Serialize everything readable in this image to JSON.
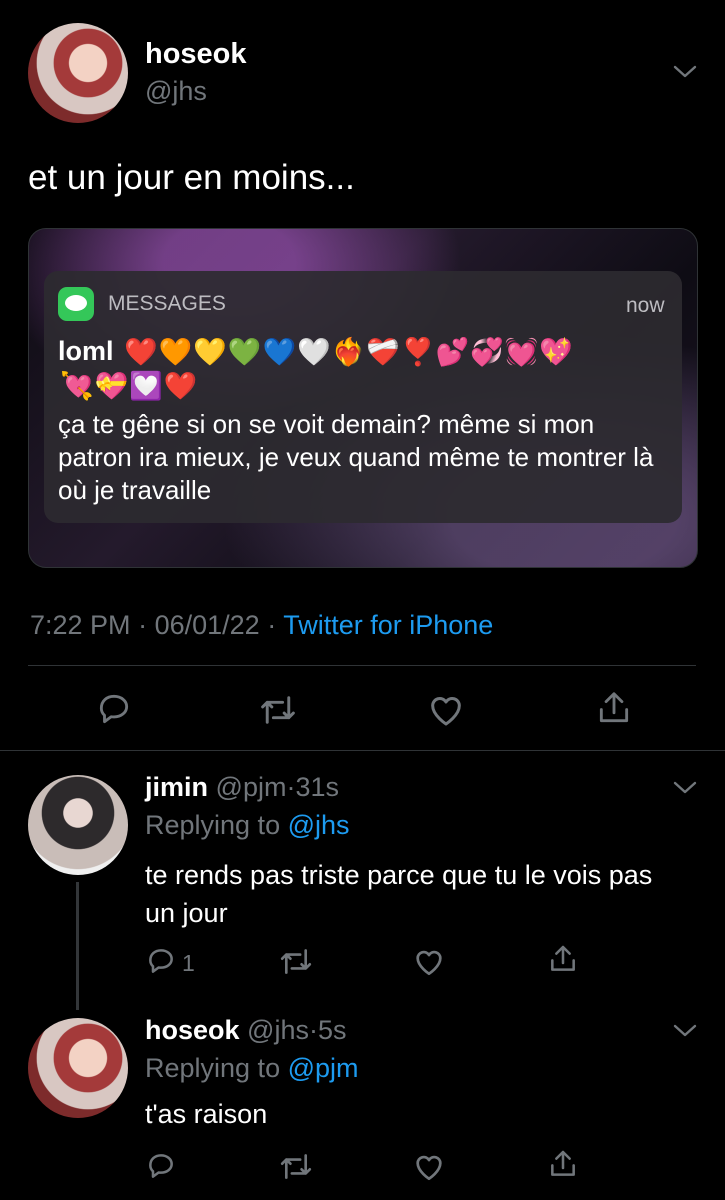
{
  "main_tweet": {
    "display_name": "hoseok",
    "handle": "@jhs",
    "text": "et un jour en moins...",
    "notification": {
      "app": "MESSAGES",
      "time": "now",
      "sender": "loml",
      "emojis_line1": "❤️🧡💛💚💙🤍❤️‍🔥❤️‍🩹❣️💕💞💓💖",
      "emojis_line2": "💘💝💟❤️",
      "body": "ça te gêne si on se voit demain? même si mon patron ira mieux, je veux quand même te montrer là où je travaille"
    },
    "meta_time": "7:22 PM",
    "meta_dot1": "·",
    "meta_date": "06/01/22",
    "meta_dot2": "·",
    "meta_source": "Twitter for iPhone"
  },
  "reply1": {
    "display_name": "jimin",
    "handle": "@pjm",
    "dot": "·",
    "time": "31s",
    "replying_prefix": "Replying to",
    "replying_to": "@jhs",
    "text": "te rends pas triste parce que tu le vois pas un jour",
    "reply_count": "1"
  },
  "reply2": {
    "display_name": "hoseok",
    "handle": "@jhs",
    "dot": "·",
    "time": "5s",
    "replying_prefix": "Replying to",
    "replying_to": "@pjm",
    "text": "t'as raison"
  },
  "colors": {
    "background": "#000000",
    "accent_link": "#1d9bf0",
    "muted_text": "#71767b",
    "imessage_green": "#34c759"
  },
  "icons": [
    "chevron-down-icon",
    "reply-icon",
    "retweet-icon",
    "like-icon",
    "share-icon",
    "messages-app-icon"
  ]
}
